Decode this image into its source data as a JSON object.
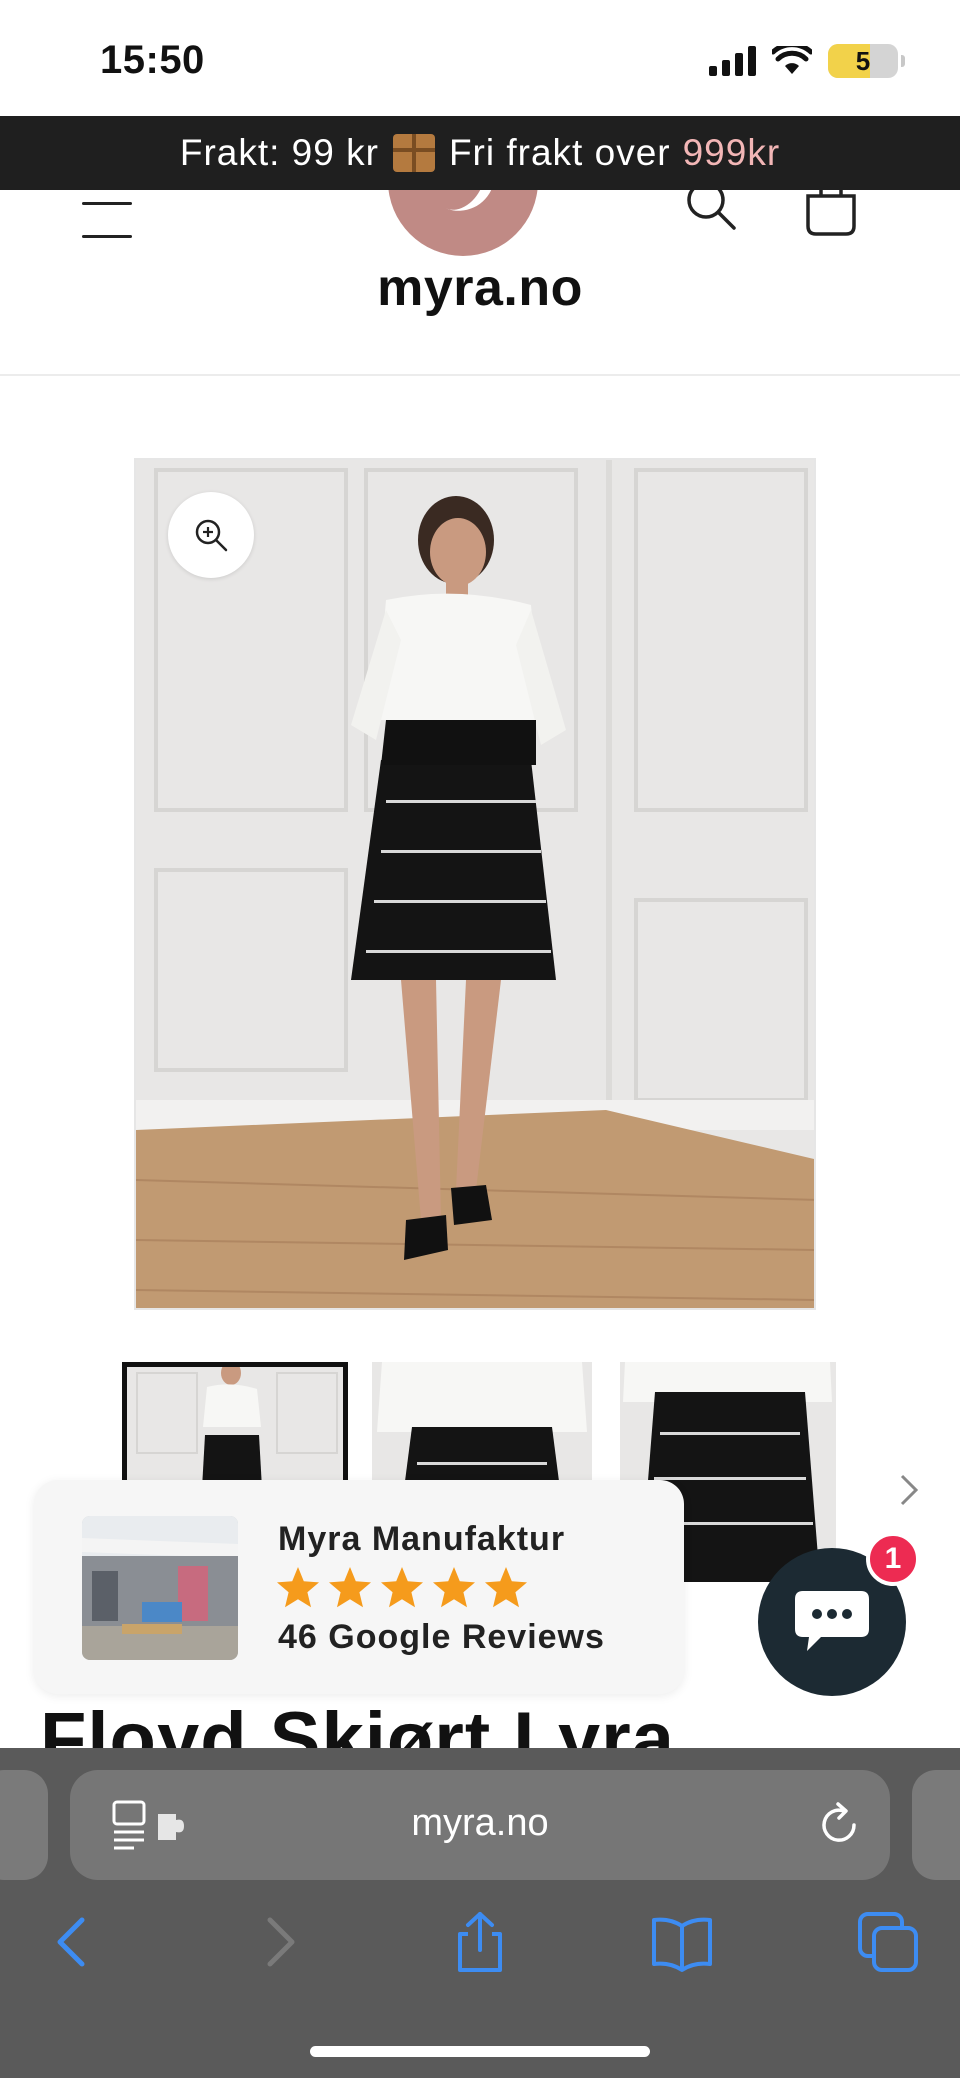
{
  "status_bar": {
    "time": "15:50",
    "battery_level": "5"
  },
  "announcement": {
    "shipping_text": "Frakt: 99 kr",
    "free_shipping_text": "Fri frakt over",
    "threshold": "999kr",
    "accent_color": "#f2b6b6",
    "box_icon": "package-icon"
  },
  "header": {
    "logo_text": "myra.no",
    "logo_color": "#c08a85",
    "menu_icon": "hamburger-menu-icon",
    "search_icon": "search-icon",
    "cart_icon": "shopping-bag-icon"
  },
  "product": {
    "title": "Floyd Skjørt Lyra",
    "zoom_icon": "zoom-in-icon",
    "thumbnail_count": 3
  },
  "review_widget": {
    "business_name": "Myra Manufaktur",
    "rating": 5,
    "max_rating": 5,
    "reviews_label": "46 Google Reviews",
    "star_color": "#f59b1c"
  },
  "chat": {
    "icon": "chat-bubble-icon",
    "unread_count": "1",
    "badge_color": "#ed2b52"
  },
  "browser": {
    "url": "myra.no",
    "accent_color": "#3d8cf2"
  }
}
